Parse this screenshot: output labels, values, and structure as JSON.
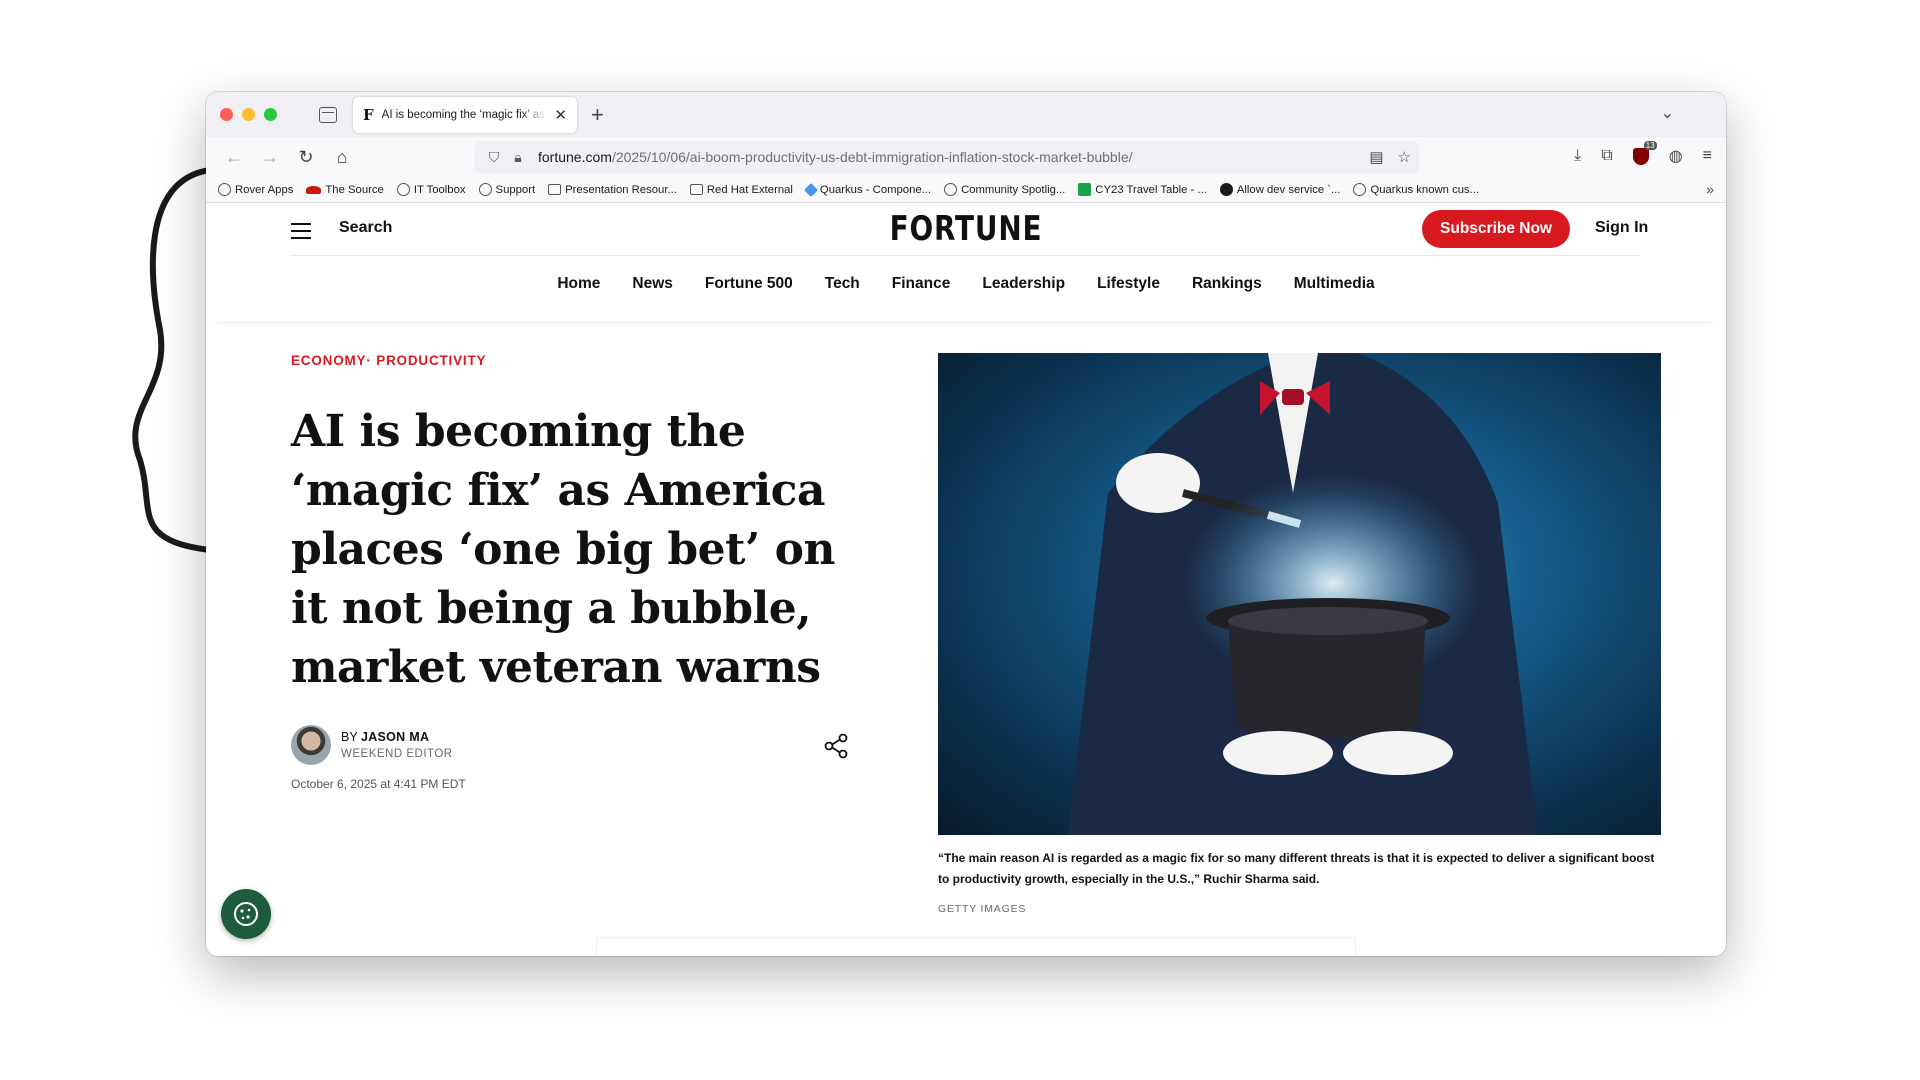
{
  "browser": {
    "tab": {
      "title": "AI is becoming the ‘magic fix’ as America places ‘one big bet’ on it not being a bubble, market veteran warns",
      "favicon": "F"
    },
    "url": {
      "domain": "fortune.com",
      "path": "/2025/10/06/ai-boom-productivity-us-debt-immigration-inflation-stock-market-bubble/"
    },
    "bookmarks": [
      {
        "label": "Rover Apps",
        "icon": "globe-icon"
      },
      {
        "label": "The Source",
        "icon": "redhat-icon"
      },
      {
        "label": "IT Toolbox",
        "icon": "globe-icon"
      },
      {
        "label": "Support",
        "icon": "globe-icon"
      },
      {
        "label": "Presentation Resour...",
        "icon": "folder-icon"
      },
      {
        "label": "Red Hat External",
        "icon": "folder-icon"
      },
      {
        "label": "Quarkus - Compone...",
        "icon": "quarkus-icon"
      },
      {
        "label": "Community Spotlig...",
        "icon": "globe-icon"
      },
      {
        "label": "CY23 Travel Table - ...",
        "icon": "sheets-icon"
      },
      {
        "label": "Allow dev service `...",
        "icon": "github-icon"
      },
      {
        "label": "Quarkus known cus...",
        "icon": "globe-icon"
      }
    ],
    "ublock_count": "13"
  },
  "site": {
    "search_label": "Search",
    "logo": "FORTUNE",
    "subscribe_label": "Subscribe Now",
    "signin_label": "Sign In",
    "nav": [
      "Home",
      "News",
      "Fortune 500",
      "Tech",
      "Finance",
      "Leadership",
      "Lifestyle",
      "Rankings",
      "Multimedia"
    ]
  },
  "article": {
    "category": "ECONOMY· PRODUCTIVITY",
    "headline": "AI is becoming the ‘magic fix’ as America places ‘one big bet’ on it not being a bubble, market veteran warns",
    "byline_prefix": "BY",
    "author": "JASON MA",
    "author_role": "WEEKEND EDITOR",
    "date": "October 6, 2025 at 4:41 PM EDT",
    "image_caption": "“The main reason AI is regarded as a magic fix for so many different threats is that it is expected to deliver a significant boost to productivity growth, especially in the U.S.,” Ruchir Sharma said.",
    "image_credit": "GETTY IMAGES"
  },
  "colors": {
    "accent": "#d91920",
    "cookie_button": "#1e5a3c"
  }
}
